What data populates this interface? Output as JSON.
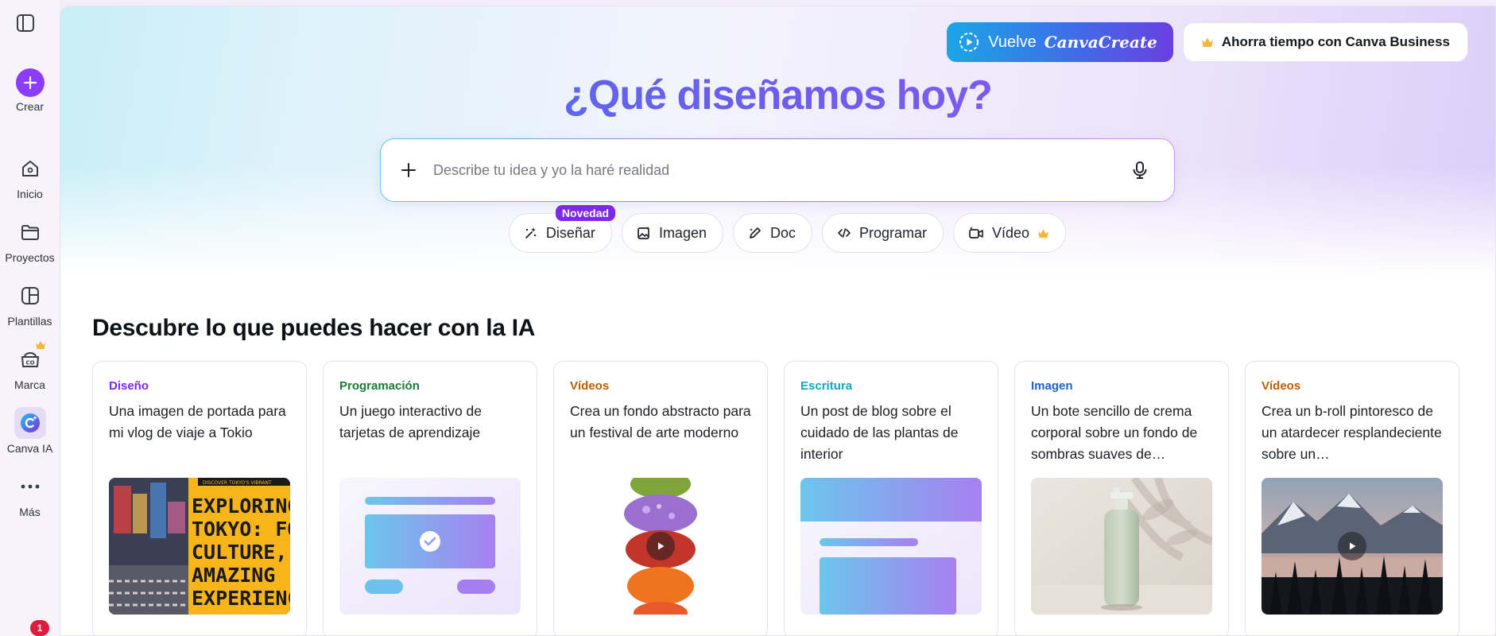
{
  "sidebar": {
    "create_label": "Crear",
    "items": [
      {
        "label": "Inicio",
        "icon": "home-icon"
      },
      {
        "label": "Proyectos",
        "icon": "folder-icon"
      },
      {
        "label": "Plantillas",
        "icon": "templates-icon"
      },
      {
        "label": "Marca",
        "icon": "brand-icon"
      },
      {
        "label": "Canva IA",
        "icon": "canva-ai-icon"
      },
      {
        "label": "Más",
        "icon": "more-icon"
      }
    ],
    "notification_count": "1"
  },
  "header": {
    "create_btn_prefix": "Vuelve",
    "create_btn_brand": "CanvaCreate",
    "business_btn": "Ahorra tiempo con Canva Business"
  },
  "hero": {
    "title": "¿Qué diseñamos hoy?",
    "search_placeholder": "Describe tu idea y yo la haré realidad"
  },
  "chips": [
    {
      "label": "Diseñar",
      "badge": "Novedad",
      "icon": "sparkle-pen-icon"
    },
    {
      "label": "Imagen",
      "icon": "image-sparkle-icon"
    },
    {
      "label": "Doc",
      "icon": "pen-sparkle-icon"
    },
    {
      "label": "Programar",
      "icon": "code-icon"
    },
    {
      "label": "Vídeo",
      "icon": "video-icon"
    }
  ],
  "section": {
    "title": "Descubre lo que puedes hacer con la IA"
  },
  "cards": [
    {
      "category": "Diseño",
      "text": "Una imagen de portada para mi vlog de viaje a Tokio",
      "color": "#7d2ae8"
    },
    {
      "category": "Programación",
      "text": "Un juego interactivo de tarjetas de aprendizaje",
      "color": "#1c7a3a"
    },
    {
      "category": "Vídeos",
      "text": "Crea un fondo abstracto para un festival de arte moderno",
      "color": "#b8600a"
    },
    {
      "category": "Escritura",
      "text": "Un post de blog sobre el cuidado de las plantas de interior",
      "color": "#13a6bf"
    },
    {
      "category": "Imagen",
      "text": "Un bote sencillo de crema corporal sobre un fondo de sombras suaves de…",
      "color": "#1f63c9"
    },
    {
      "category": "Vídeos",
      "text": "Crea un b-roll pintoresco de un atardecer resplandeciente sobre un…",
      "color": "#b8600a"
    }
  ],
  "thumb_text": {
    "tokyo_banner": "DISCOVER TOKYO'S VIBRANT",
    "tokyo_headline_1": "EXPLORING",
    "tokyo_headline_2": "TOKYO: FO",
    "tokyo_headline_3": "CULTURE,",
    "tokyo_headline_4": "AMAZING",
    "tokyo_headline_5": "EXPERIENC"
  }
}
